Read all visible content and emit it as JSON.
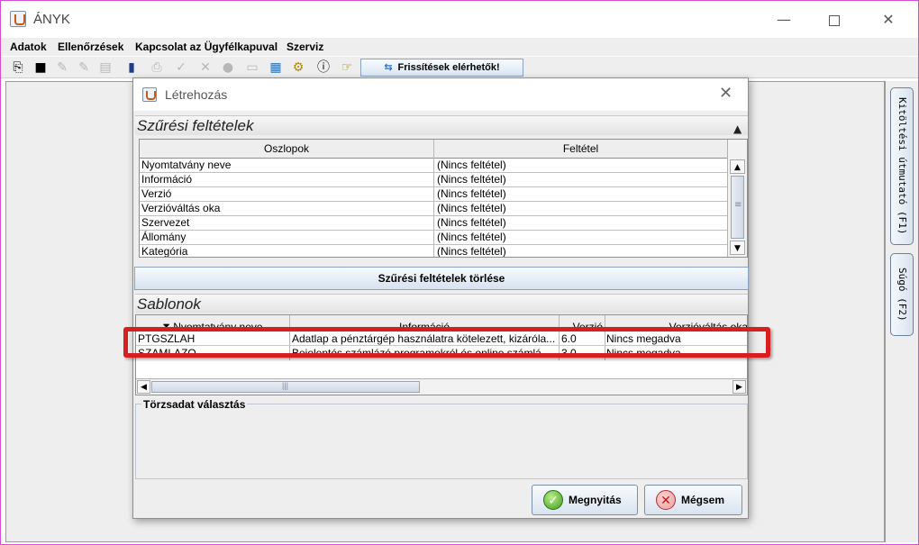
{
  "window": {
    "title": "ÁNYK",
    "min_glyph": "—",
    "close_glyph": "✕"
  },
  "menu": [
    "Adatok",
    "Ellenőrzések",
    "Kapcsolat az Ügyfélkapuval",
    "Szerviz"
  ],
  "toolbar": {
    "icons": [
      "copy-icon",
      "save-icon",
      "edit-icon",
      "edit2-icon",
      "document-icon",
      "info-key-icon",
      "print-icon",
      "check-icon",
      "cross-icon",
      "sign-icon",
      "card-icon",
      "calculator-icon",
      "gears-icon",
      "info-icon",
      "pointer-icon"
    ],
    "update_button": "Frissítések elérhetők!"
  },
  "side_tabs": {
    "guide": "Kitöltési útmutató (F1)",
    "help": "Súgó (F2)"
  },
  "dialog": {
    "title": "Létrehozás",
    "filter_section": "Szűrési feltételek",
    "filter_columns": [
      "Oszlopok",
      "Feltétel"
    ],
    "filter_rows": [
      [
        "Nyomtatvány neve",
        "(Nincs feltétel)"
      ],
      [
        "Információ",
        "(Nincs feltétel)"
      ],
      [
        "Verzió",
        "(Nincs feltétel)"
      ],
      [
        "Verzióváltás oka",
        "(Nincs feltétel)"
      ],
      [
        "Szervezet",
        "(Nincs feltétel)"
      ],
      [
        "Állomány",
        "(Nincs feltétel)"
      ],
      [
        "Kategória",
        "(Nincs feltétel)"
      ]
    ],
    "clear_filters_button": "Szűrési feltételek törlése",
    "templates_section": "Sablonok",
    "template_columns": [
      "Nyomtatvány neve",
      "Információ",
      "Verzió",
      "Verzióváltás oka"
    ],
    "template_rows": [
      [
        "PTGSZLAH",
        "Adatlap a pénztárgép használatra kötelezett, kizáróla...",
        "6.0",
        "Nincs megadva"
      ],
      [
        "SZAMLAZO",
        "Bejelentés számlázó programokról és online számlá...",
        "3.0",
        "Nincs megadva"
      ]
    ],
    "master_data_label": "Törzsadat választás",
    "open_button": "Megnyitás",
    "cancel_button": "Mégsem"
  },
  "colors": {
    "highlight": "#d81f1f",
    "frame": "#d24fd2"
  }
}
